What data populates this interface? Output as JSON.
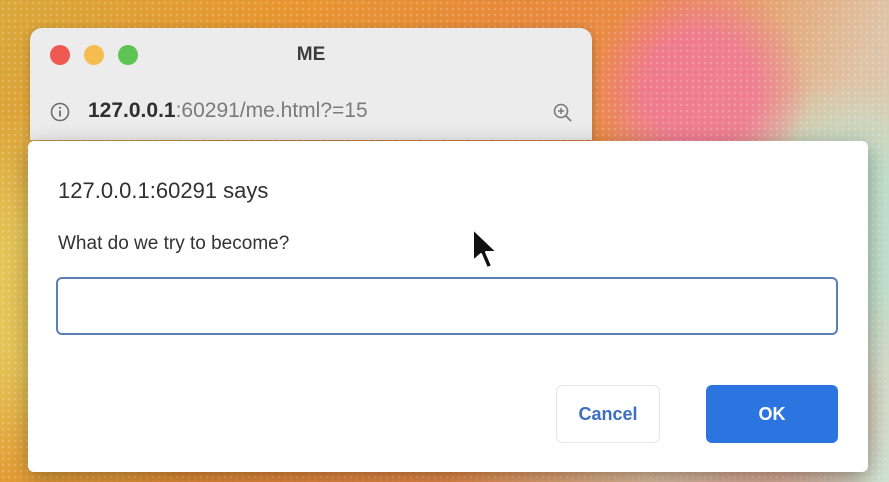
{
  "window": {
    "title": "ME",
    "controls": [
      "close",
      "minimize",
      "maximize"
    ]
  },
  "address_bar": {
    "info_icon": "info-icon",
    "url_host": "127.0.0.1",
    "url_rest": ":60291/me.html?=15",
    "zoom_icon": "zoom-in-icon"
  },
  "dialog": {
    "origin": "127.0.0.1:60291 says",
    "message": "What do we try to become?",
    "input_value": "",
    "cancel_label": "Cancel",
    "ok_label": "OK"
  },
  "colors": {
    "close": "#ee5a52",
    "minimize": "#f5bd4f",
    "maximize": "#5ec454",
    "accent": "#2c75e0",
    "input_border": "#5b7fb7"
  }
}
